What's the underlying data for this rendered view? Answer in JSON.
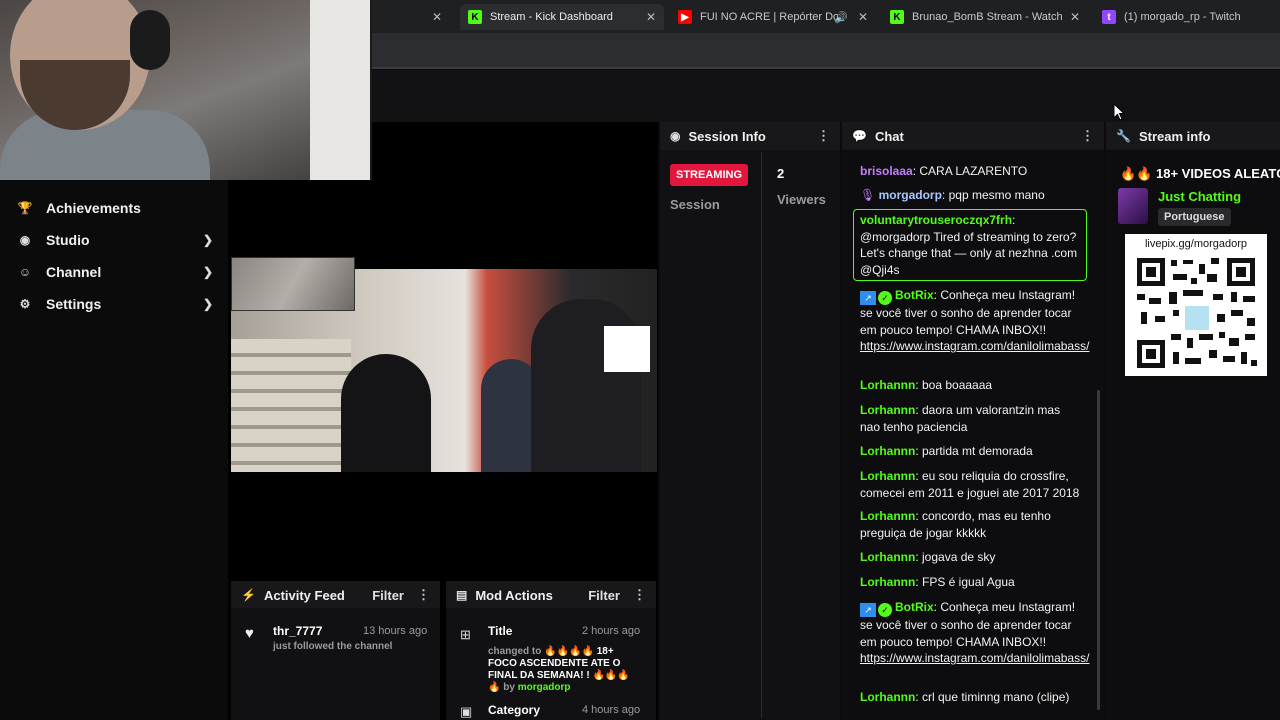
{
  "browser": {
    "tabs": [
      {
        "title": "Stream - Kick Dashboard",
        "active": true,
        "favicon": "K",
        "favicon_color": "#53fc18"
      },
      {
        "title": "FUI NO ACRE | Repórter Do",
        "favicon": "▶",
        "favicon_color": "#ff0000",
        "has_audio": true
      },
      {
        "title": "Brunao_BomB Stream - Watch L",
        "favicon": "K",
        "favicon_color": "#53fc18"
      },
      {
        "title": "(1) morgado_rp - Twitch",
        "favicon": "t",
        "favicon_color": "#9146ff"
      }
    ]
  },
  "sidebar": {
    "items": [
      {
        "label": "Achievements",
        "icon": "trophy-icon",
        "has_chevron": false
      },
      {
        "label": "Studio",
        "icon": "camera-icon",
        "has_chevron": true
      },
      {
        "label": "Channel",
        "icon": "channel-icon",
        "has_chevron": true
      },
      {
        "label": "Settings",
        "icon": "gear-icon",
        "has_chevron": true
      }
    ]
  },
  "session_info": {
    "title": "Session Info",
    "status": "STREAMING",
    "session_label": "Session",
    "viewers_count": "2",
    "viewers_label": "Viewers"
  },
  "chat": {
    "title": "Chat",
    "messages": [
      {
        "user": "brisolaaa",
        "color": "#c77dff",
        "text": "CARA LAZARENTO"
      },
      {
        "user": "morgadorp",
        "color": "#a7c7ff",
        "text": "pqp mesmo mano",
        "mic_icon": true
      },
      {
        "user": "voluntarytrouseroczqx7frh",
        "color": "#53fc18",
        "text": "@morgadorp Tired of streaming to zero? Let's change that — only at nezhna .com @Qji4s",
        "highlighted": true
      },
      {
        "user": "BotRix",
        "color": "#53fc18",
        "text": "Conheça meu Instagram! se você tiver o sonho de aprender tocar em pouco tempo! CHAMA INBOX!!",
        "link": "https://www.instagram.com/danilolimabass/",
        "bot": true
      },
      {
        "user": "Lorhannn",
        "color": "#53fc18",
        "text": "boa boaaaaa"
      },
      {
        "user": "Lorhannn",
        "color": "#53fc18",
        "text": "daora um valorantzin mas nao tenho paciencia"
      },
      {
        "user": "Lorhannn",
        "color": "#53fc18",
        "text": "partida mt demorada"
      },
      {
        "user": "Lorhannn",
        "color": "#53fc18",
        "text": "eu sou reliquia do crossfire, comecei em 2011 e joguei ate 2017 2018"
      },
      {
        "user": "Lorhannn",
        "color": "#53fc18",
        "text": "concordo, mas eu tenho preguiça de jogar kkkkk"
      },
      {
        "user": "Lorhannn",
        "color": "#53fc18",
        "text": "jogava de sky"
      },
      {
        "user": "Lorhannn",
        "color": "#53fc18",
        "text": "FPS é igual Agua"
      },
      {
        "user": "BotRix",
        "color": "#53fc18",
        "text": "Conheça meu Instagram! se você tiver o sonho de aprender tocar em pouco tempo! CHAMA INBOX!!",
        "link": "https://www.instagram.com/danilolimabass/",
        "bot": true
      },
      {
        "user": "Lorhannn",
        "color": "#53fc18",
        "text": "crl que timinng mano (clipe)"
      }
    ]
  },
  "stream_info": {
    "title_header": "Stream info",
    "stream_title": "🔥🔥 18+ VIDEOS ALEATÓ",
    "category": "Just Chatting",
    "language": "Portuguese",
    "qr_url": "livepix.gg/morgadorp"
  },
  "activity_feed": {
    "title": "Activity Feed",
    "filter_label": "Filter",
    "items": [
      {
        "user": "thr_7777",
        "time": "13 hours ago",
        "action": "just followed the channel"
      }
    ]
  },
  "mod_actions": {
    "title": "Mod Actions",
    "filter_label": "Filter",
    "items": [
      {
        "type": "Title",
        "time": "2 hours ago",
        "prefix": "changed to",
        "value": "🔥🔥🔥🔥 18+ FOCO ASCENDENTE ATE O FINAL DA SEMANA! ! 🔥🔥🔥🔥",
        "by_label": "by",
        "by_user": "morgadorp"
      },
      {
        "type": "Category",
        "time": "4 hours ago"
      }
    ]
  }
}
